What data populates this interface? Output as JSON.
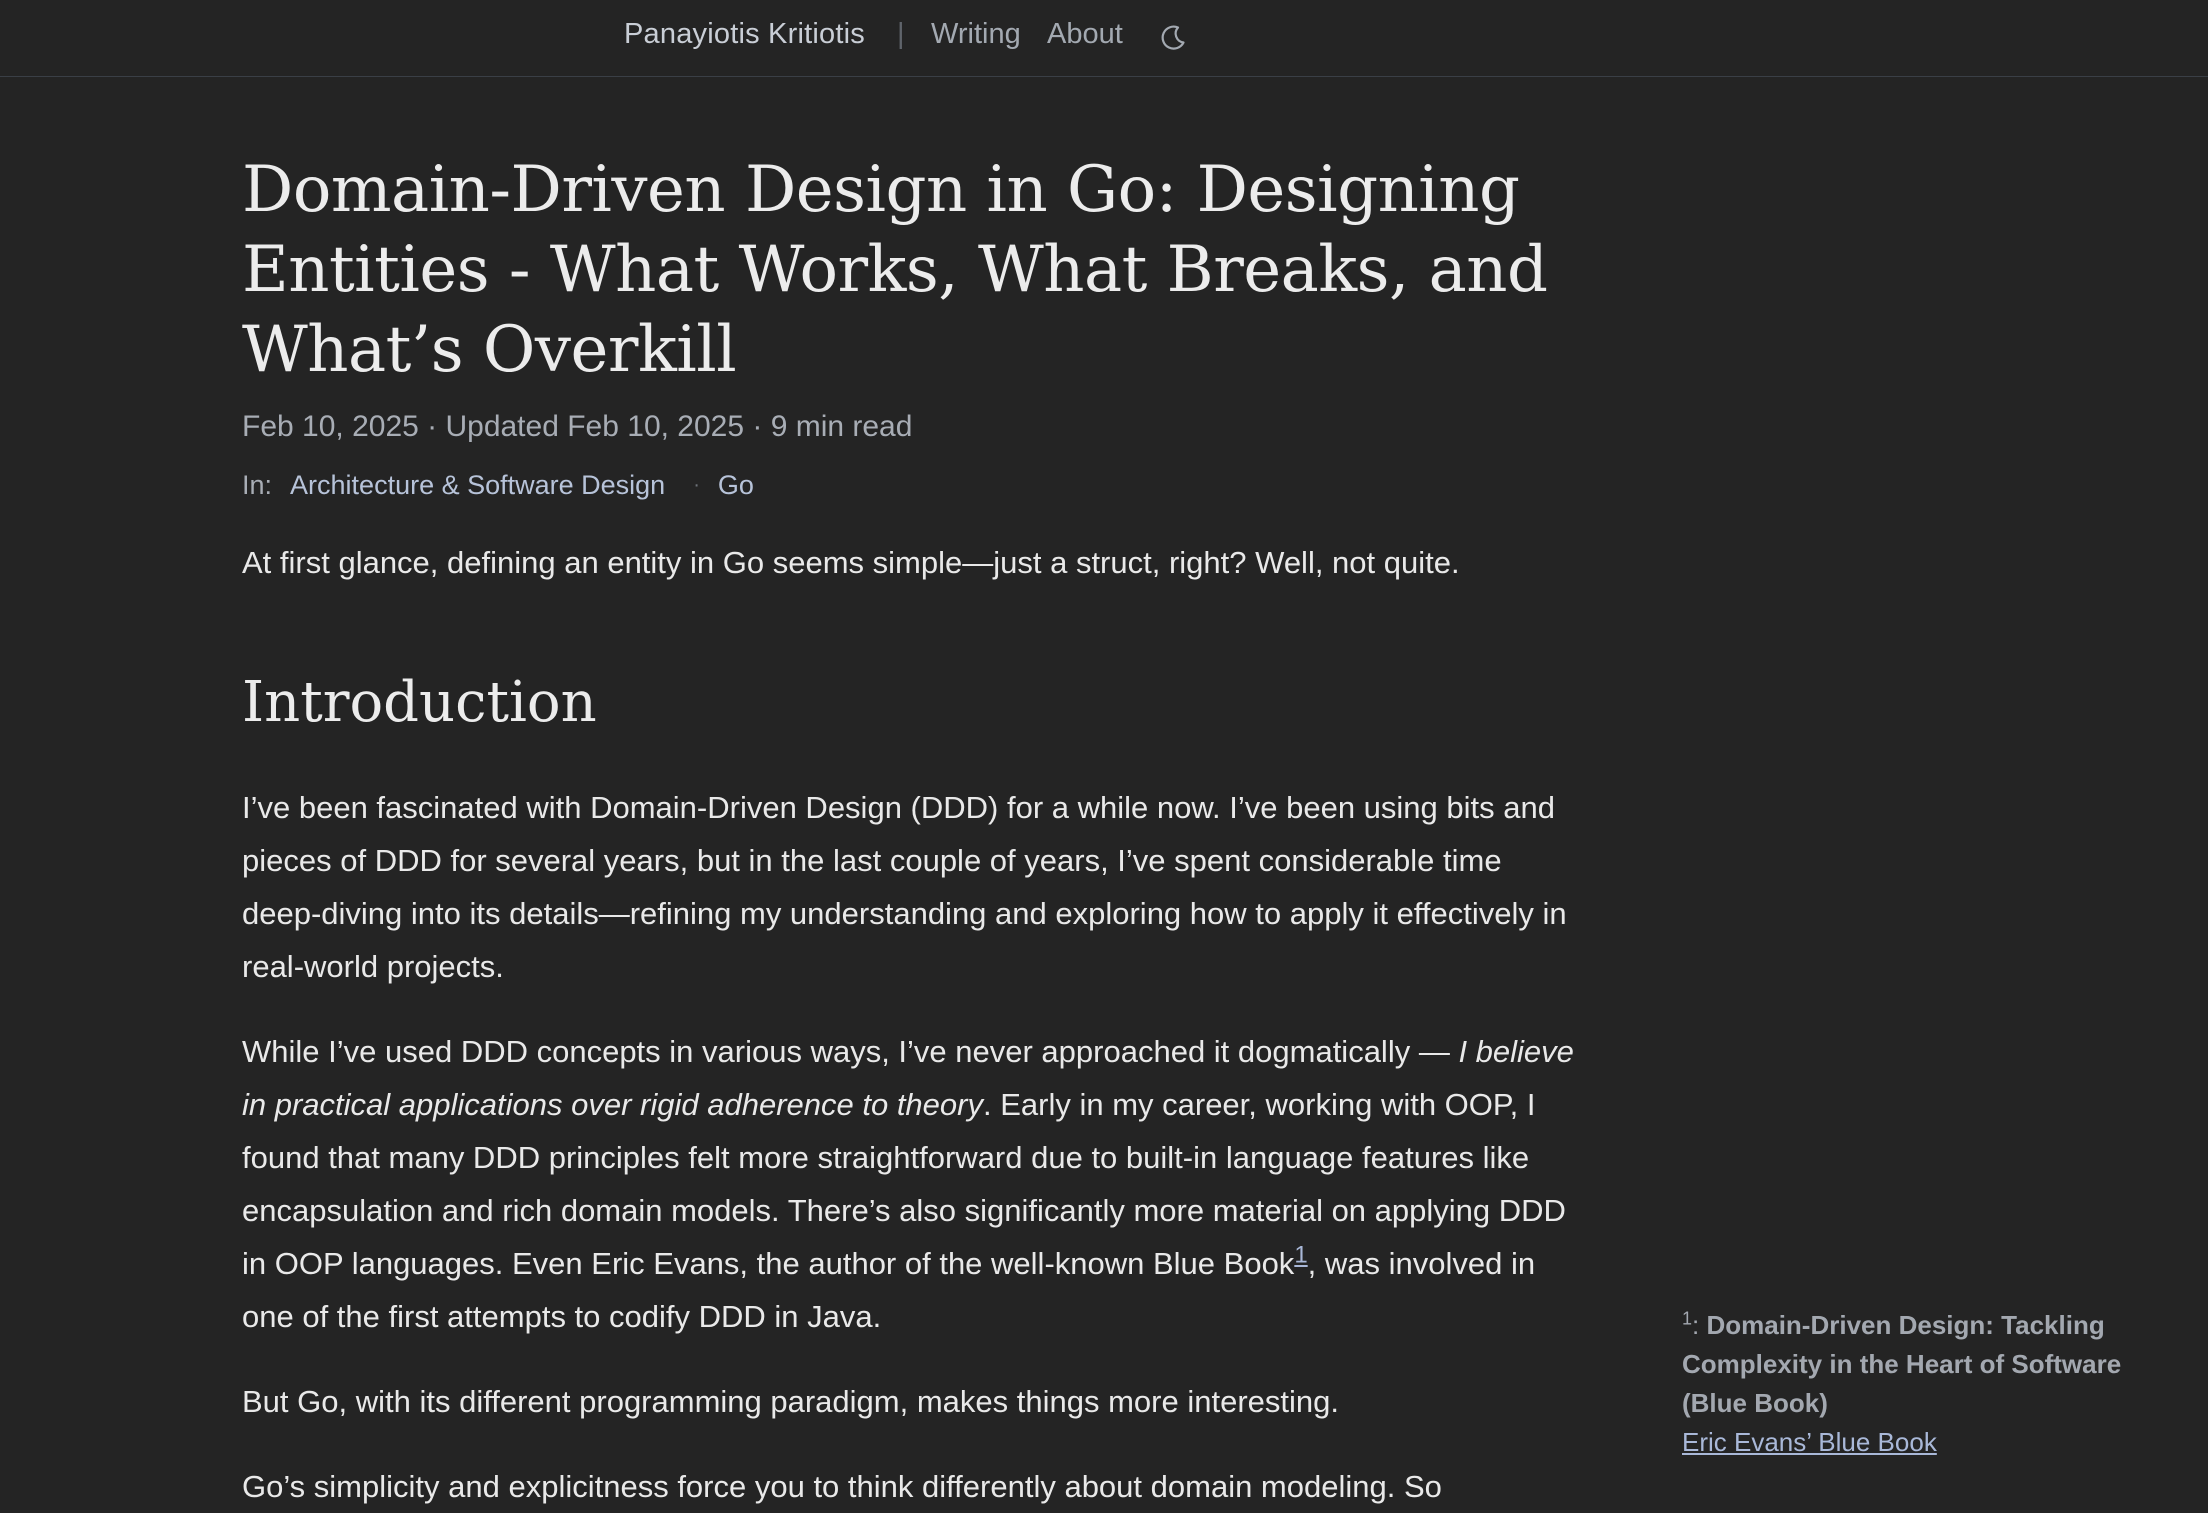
{
  "header": {
    "brand": "Panayiotis Kritiotis",
    "separator": "|",
    "nav": [
      {
        "label": "Writing"
      },
      {
        "label": "About"
      }
    ],
    "theme_icon": "moon-icon"
  },
  "article": {
    "title": "Domain-Driven Design in Go: Designing Entities - What Works, What Breaks, and What’s Overkill",
    "meta": "Feb 10, 2025 · Updated Feb 10, 2025 · 9 min read",
    "tags_label": "In:",
    "tags": [
      "Architecture & Software Design",
      "Go"
    ],
    "tag_separator": "·",
    "lead": "At first glance, defining an entity in Go seems simple—just a struct, right? Well, not quite.",
    "section_heading": "Introduction",
    "p1": "I’ve been fascinated with Domain-Driven Design (DDD) for a while now. I’ve been using bits and pieces of DDD for several years, but in the last couple of years, I’ve spent considerable time deep-diving into its details—refining my understanding and exploring how to apply it effectively in real-world projects.",
    "p2_start": "While I’ve used DDD concepts in various ways, I’ve never approached it dogmatically — ",
    "p2_italic": "I believe in practical applications over rigid adherence to theory",
    "p2_middle": ". Early in my career, working with OOP, I found that many DDD principles felt more straightforward due to built-in language features like encapsulation and rich domain models. There’s also significantly more material on applying DDD in OOP languages. Even Eric Evans, the author of the well-known Blue Book",
    "p2_fn": "1",
    "p2_end": ", was involved in one of the first attempts to codify DDD in Java.",
    "p3": "But Go, with its different programming paradigm, makes things more interesting.",
    "p4_partial": "Go’s simplicity and explicitness force you to think differently about domain modeling. So"
  },
  "sidenote": {
    "number": "1",
    "colon": ": ",
    "title": "Domain-Driven Design: Tackling Complexity in the Heart of Software (Blue Book)",
    "link": "Eric Evans’ Blue Book"
  }
}
